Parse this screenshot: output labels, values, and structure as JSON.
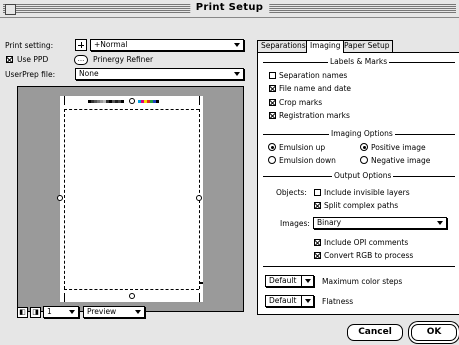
{
  "window": {
    "title": "Print Setup"
  },
  "left": {
    "print_setting_label": "Print setting:",
    "print_setting_value": "+Normal",
    "use_ppd_label": "Use PPD",
    "use_ppd_checked": true,
    "printer_glyph": "...",
    "printer_name": "Prinergy Refiner",
    "userprep_label": "UserPrep file:",
    "userprep_value": "None",
    "page_number": "1",
    "view_mode": "Preview"
  },
  "tabs": [
    {
      "label": "Separations",
      "active": false
    },
    {
      "label": "Imaging",
      "active": true
    },
    {
      "label": "Paper Setup",
      "active": false
    }
  ],
  "imaging": {
    "labels_marks_title": "Labels & Marks",
    "marks": [
      {
        "label": "Separation names",
        "checked": false
      },
      {
        "label": "File name and date",
        "checked": true
      },
      {
        "label": "Crop marks",
        "checked": true
      },
      {
        "label": "Registration marks",
        "checked": true
      }
    ],
    "imaging_options_title": "Imaging Options",
    "emulsion": [
      {
        "label": "Emulsion up",
        "selected": true
      },
      {
        "label": "Emulsion down",
        "selected": false
      }
    ],
    "image_polarity": [
      {
        "label": "Positive image",
        "selected": true
      },
      {
        "label": "Negative image",
        "selected": false
      }
    ],
    "output_options_title": "Output Options",
    "objects_label": "Objects:",
    "include_invisible_layers": {
      "label": "Include invisible layers",
      "checked": false
    },
    "split_complex_paths": {
      "label": "Split complex paths",
      "checked": true
    },
    "images_label": "Images:",
    "images_value": "Binary",
    "include_opi_comments": {
      "label": "Include OPI comments",
      "checked": true
    },
    "convert_rgb": {
      "label": "Convert RGB to process",
      "checked": true
    },
    "max_color_steps": {
      "value": "Default",
      "label": "Maximum color steps"
    },
    "flatness": {
      "value": "Default",
      "label": "Flatness"
    }
  },
  "buttons": {
    "cancel": "Cancel",
    "ok": "OK"
  }
}
